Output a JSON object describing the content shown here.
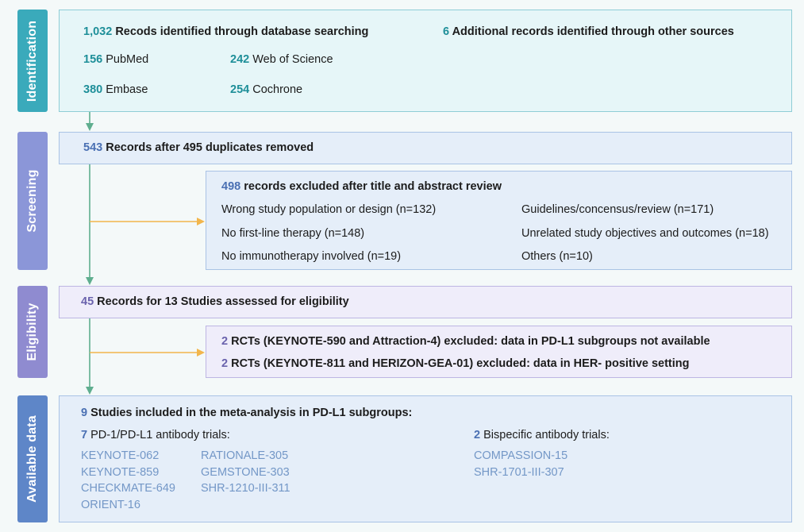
{
  "stages": {
    "identification": {
      "label": "Identification",
      "color": "#3aaabb"
    },
    "screening": {
      "label": "Screening",
      "color": "#8b96d8"
    },
    "eligibility": {
      "label": "Eligibility",
      "color": "#8f8bd0"
    },
    "available_data": {
      "label": "Available data",
      "color": "#5e86c8"
    }
  },
  "identification": {
    "database_count": "1,032",
    "database_text": " Recods identified through database searching",
    "other_count": "6",
    "other_text": " Additional records identified through other sources",
    "sources": [
      {
        "count": "156",
        "name": " PubMed"
      },
      {
        "count": "242",
        "name": " Web of Science"
      },
      {
        "count": "380",
        "name": " Embase"
      },
      {
        "count": "254",
        "name": " Cochrone"
      }
    ]
  },
  "screening": {
    "records_count": "543",
    "records_text": " Records after 495 duplicates removed",
    "excluded_count": "498",
    "excluded_text": " records excluded after title and abstract review",
    "reasons": [
      "Wrong study population or design (n=132)",
      "Guidelines/concensus/review (n=171)",
      "No first-line therapy (n=148)",
      "Unrelated study objectives and outcomes (n=18)",
      "No immunotherapy involved (n=19)",
      "Others (n=10)"
    ]
  },
  "eligibility": {
    "records_count": "45",
    "records_text": " Records for 13 Studies assessed for eligibility",
    "exclusions": [
      {
        "count": "2",
        "text": " RCTs (KEYNOTE-590 and Attraction-4) excluded: data in PD-L1 subgroups not available"
      },
      {
        "count": "2",
        "text": " RCTs (KEYNOTE-811 and HERIZON-GEA-01) excluded: data in HER- positive setting"
      }
    ]
  },
  "available": {
    "included_count": "9",
    "included_text": " Studies included in the meta-analysis in PD-L1 subgroups:",
    "pd1_count": "7",
    "pd1_text": " PD-1/PD-L1 antibody trials:",
    "pd1_trials": [
      "KEYNOTE-062",
      "KEYNOTE-859",
      "CHECKMATE-649",
      "ORIENT-16",
      "RATIONALE-305",
      "GEMSTONE-303",
      "SHR-1210-III-311"
    ],
    "bispecific_count": "2",
    "bispecific_text": " Bispecific antibody trials:",
    "bispecific_trials": [
      "COMPASSION-15",
      "SHR-1701-III-307"
    ]
  }
}
